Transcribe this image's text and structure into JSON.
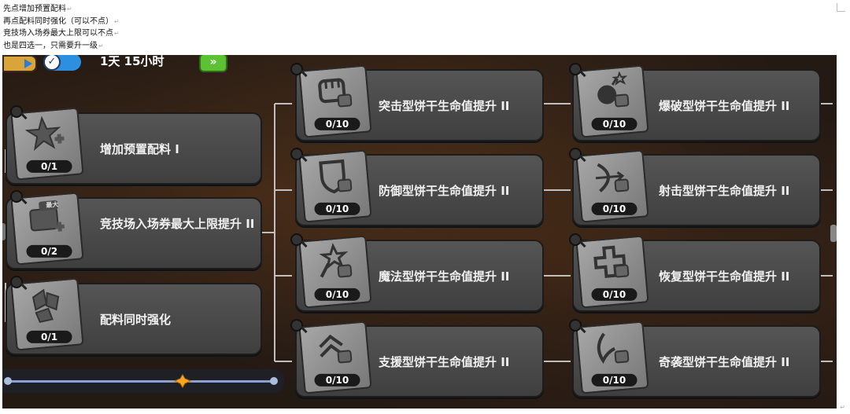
{
  "doc": {
    "lines": [
      "先点增加预置配料",
      "再点配料同时强化（可以不点）",
      "竞技场入场券最大上限可以不点",
      "也是四选一，只需要升一级"
    ],
    "para_mark": "↵"
  },
  "top": {
    "timer": "1天 15小时",
    "ff_label": "»"
  },
  "left_cards": [
    {
      "label": "增加预置配料 I",
      "count": "0/1",
      "icon": "star-plus-icon"
    },
    {
      "label": "竞技场入场券最大上限提升 II",
      "count": "0/2",
      "icon": "ticket-plus-icon",
      "badge": "最大"
    },
    {
      "label": "配料同时强化",
      "count": "0/1",
      "icon": "shards-icon"
    }
  ],
  "mid_cards": [
    {
      "label": "突击型饼干生命值提升 II",
      "count": "0/10",
      "icon": "fist-icon"
    },
    {
      "label": "防御型饼干生命值提升 II",
      "count": "0/10",
      "icon": "shield-icon"
    },
    {
      "label": "魔法型饼干生命值提升 II",
      "count": "0/10",
      "icon": "wand-icon"
    },
    {
      "label": "支援型饼干生命值提升 II",
      "count": "0/10",
      "icon": "chevrons-icon"
    }
  ],
  "right_cards": [
    {
      "label": "爆破型饼干生命值提升 II",
      "count": "0/10",
      "icon": "bomb-icon"
    },
    {
      "label": "射击型饼干生命值提升 II",
      "count": "0/10",
      "icon": "bow-icon"
    },
    {
      "label": "恢复型饼干生命值提升 II",
      "count": "0/10",
      "icon": "cross-icon"
    },
    {
      "label": "奇袭型饼干生命值提升 II",
      "count": "0/10",
      "icon": "claw-icon"
    }
  ],
  "colors": {
    "accent_green": "#5cc233",
    "card": "#4a4a4a",
    "background": "#241a14"
  }
}
